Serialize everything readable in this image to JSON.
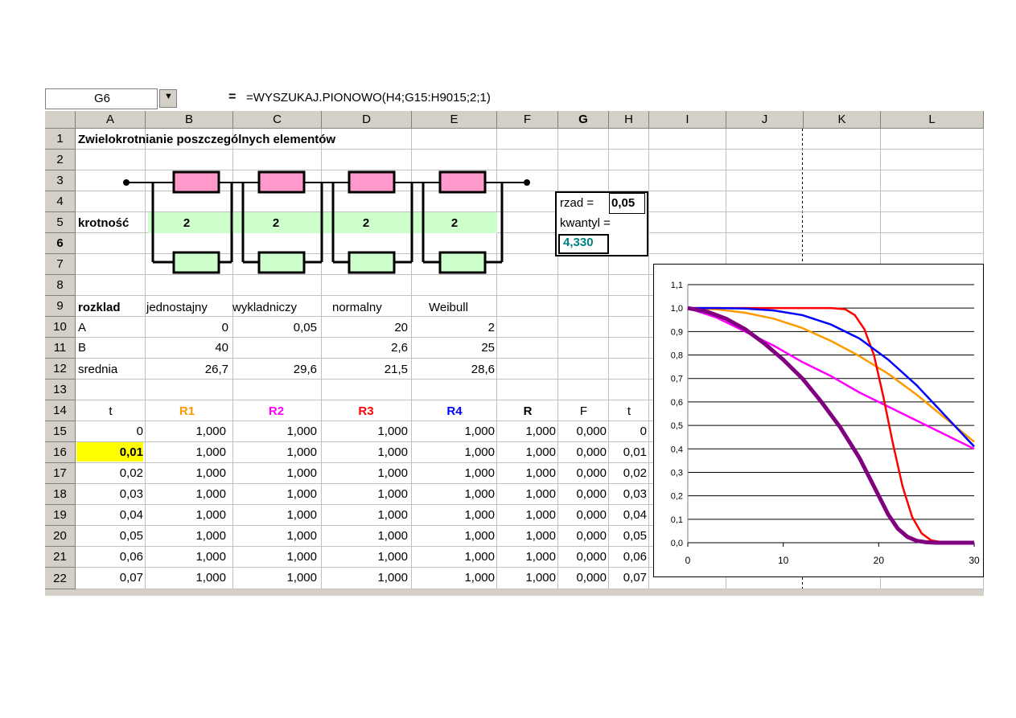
{
  "name_box": "G6",
  "formula": "=WYSZUKAJ.PIONOWO(H4;G15:H9015;2;1)",
  "formula_eq": "=",
  "columns": [
    "A",
    "B",
    "C",
    "D",
    "E",
    "F",
    "G",
    "H",
    "I",
    "J",
    "K",
    "L"
  ],
  "rows": [
    "1",
    "2",
    "3",
    "4",
    "5",
    "6",
    "7",
    "8",
    "9",
    "10",
    "11",
    "12",
    "13",
    "14",
    "15",
    "16",
    "17",
    "18",
    "19",
    "20",
    "21",
    "22"
  ],
  "title": "Zwielokrotnianie poszczególnych elementów",
  "krotnosc_label": "krotność",
  "krotnosci": [
    "2",
    "2",
    "2",
    "2"
  ],
  "side": {
    "rzad_label": "rzad =",
    "rzad_value": "0,05",
    "kwantyl_label": "kwantyl =",
    "kwantyl_value": "4,330"
  },
  "rozklad": {
    "label": "rozklad",
    "names": [
      "jednostajny",
      "wykladniczy",
      "normalny",
      "Weibull"
    ],
    "A_label": "A",
    "A": [
      "0",
      "0,05",
      "20",
      "2"
    ],
    "B_label": "B",
    "B": [
      "40",
      "",
      "2,6",
      "25"
    ],
    "srednia_label": "srednia",
    "srednia": [
      "26,7",
      "29,6",
      "21,5",
      "28,6"
    ]
  },
  "table_headers": [
    "t",
    "R1",
    "R2",
    "R3",
    "R4",
    "R",
    "F",
    "t"
  ],
  "header_colors": [
    "#000000",
    "#ff9900",
    "#ff00ff",
    "#ff0000",
    "#0000ff",
    "#000000",
    "#000000",
    "#000000"
  ],
  "table_rows": [
    [
      "0",
      "1,000",
      "1,000",
      "1,000",
      "1,000",
      "1,000",
      "0,000",
      "0"
    ],
    [
      "0,01",
      "1,000",
      "1,000",
      "1,000",
      "1,000",
      "1,000",
      "0,000",
      "0,01"
    ],
    [
      "0,02",
      "1,000",
      "1,000",
      "1,000",
      "1,000",
      "1,000",
      "0,000",
      "0,02"
    ],
    [
      "0,03",
      "1,000",
      "1,000",
      "1,000",
      "1,000",
      "1,000",
      "0,000",
      "0,03"
    ],
    [
      "0,04",
      "1,000",
      "1,000",
      "1,000",
      "1,000",
      "1,000",
      "0,000",
      "0,04"
    ],
    [
      "0,05",
      "1,000",
      "1,000",
      "1,000",
      "1,000",
      "1,000",
      "0,000",
      "0,05"
    ],
    [
      "0,06",
      "1,000",
      "1,000",
      "1,000",
      "1,000",
      "1,000",
      "0,000",
      "0,06"
    ],
    [
      "0,07",
      "1,000",
      "1,000",
      "1,000",
      "1,000",
      "1,000",
      "0,000",
      "0,07"
    ]
  ],
  "chart_data": {
    "type": "line",
    "title": "",
    "xlabel": "",
    "ylabel": "",
    "xlim": [
      0,
      30
    ],
    "ylim": [
      0,
      1.1
    ],
    "x_ticks": [
      "0",
      "10",
      "20",
      "30"
    ],
    "y_ticks": [
      "0,0",
      "0,1",
      "0,2",
      "0,3",
      "0,4",
      "0,5",
      "0,6",
      "0,7",
      "0,8",
      "0,9",
      "1,0",
      "1,1"
    ],
    "grid": "horizontal",
    "series": [
      {
        "color": "#ff9900",
        "x": [
          0,
          3,
          6,
          9,
          12,
          15,
          18,
          21,
          24,
          27,
          30
        ],
        "y": [
          1.0,
          0.995,
          0.98,
          0.955,
          0.915,
          0.86,
          0.795,
          0.72,
          0.63,
          0.53,
          0.43
        ]
      },
      {
        "color": "#ff00ff",
        "x": [
          0,
          3,
          6,
          9,
          12,
          15,
          18,
          21,
          24,
          27,
          30
        ],
        "y": [
          1.0,
          0.96,
          0.9,
          0.84,
          0.77,
          0.71,
          0.64,
          0.58,
          0.52,
          0.46,
          0.4
        ]
      },
      {
        "color": "#ff0000",
        "x": [
          0,
          5,
          10,
          15,
          16.5,
          17.5,
          18.5,
          19.5,
          20.5,
          21.5,
          22.5,
          23.5,
          24.5,
          25.5,
          27,
          30
        ],
        "y": [
          1.0,
          1.0,
          1.0,
          1.0,
          0.995,
          0.97,
          0.91,
          0.8,
          0.62,
          0.42,
          0.24,
          0.11,
          0.04,
          0.01,
          0.0,
          0.0
        ]
      },
      {
        "color": "#0000ff",
        "x": [
          0,
          3,
          6,
          9,
          12,
          15,
          18,
          21,
          24,
          27,
          30
        ],
        "y": [
          1.0,
          1.0,
          0.998,
          0.99,
          0.97,
          0.93,
          0.87,
          0.78,
          0.67,
          0.54,
          0.41
        ]
      },
      {
        "color": "#800080",
        "x": [
          0,
          2,
          4,
          6,
          8,
          10,
          12,
          14,
          16,
          18,
          19,
          20,
          21,
          22,
          23,
          24,
          25,
          26,
          30
        ],
        "y": [
          1.0,
          0.985,
          0.955,
          0.91,
          0.85,
          0.78,
          0.7,
          0.6,
          0.49,
          0.36,
          0.28,
          0.2,
          0.12,
          0.06,
          0.025,
          0.008,
          0.002,
          0.0,
          0.0
        ]
      }
    ]
  }
}
